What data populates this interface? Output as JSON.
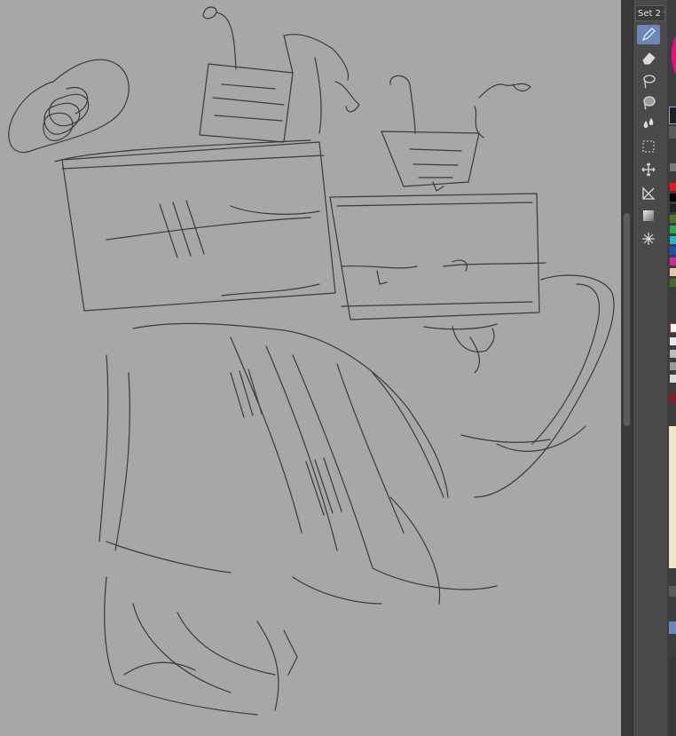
{
  "app": {
    "set_selector_label": "Set 2",
    "set_selector_arrow": "chevron-down-icon"
  },
  "tools": [
    {
      "id": "pen",
      "icon": "pen-icon",
      "active": true
    },
    {
      "id": "eraser",
      "icon": "eraser-icon",
      "active": false
    },
    {
      "id": "lasso",
      "icon": "lasso-icon",
      "active": false
    },
    {
      "id": "lasso-fill",
      "icon": "lasso-fill-icon",
      "active": false
    },
    {
      "id": "blend",
      "icon": "water-drops-icon",
      "active": false
    },
    {
      "id": "selection",
      "icon": "marquee-icon",
      "active": false
    },
    {
      "id": "move",
      "icon": "move-arrows-icon",
      "active": false
    },
    {
      "id": "ruler",
      "icon": "ruler-icon",
      "active": false
    },
    {
      "id": "gradient",
      "icon": "gradient-icon",
      "active": false
    },
    {
      "id": "sparkle",
      "icon": "sparkle-icon",
      "active": false
    }
  ],
  "colors": {
    "canvas_bg": "#a7a7a7",
    "stroke": "#3a3a3a",
    "accent": "#e0147f",
    "palette": [
      "#e11b1b",
      "#000000",
      "#222222",
      "#4d7a2a",
      "#2aa84a",
      "#28b5c6",
      "#2450a8",
      "#c42d9a",
      "#8a4d1c",
      "#e7c8a8",
      "#4b6a28",
      "#ffffff"
    ]
  }
}
